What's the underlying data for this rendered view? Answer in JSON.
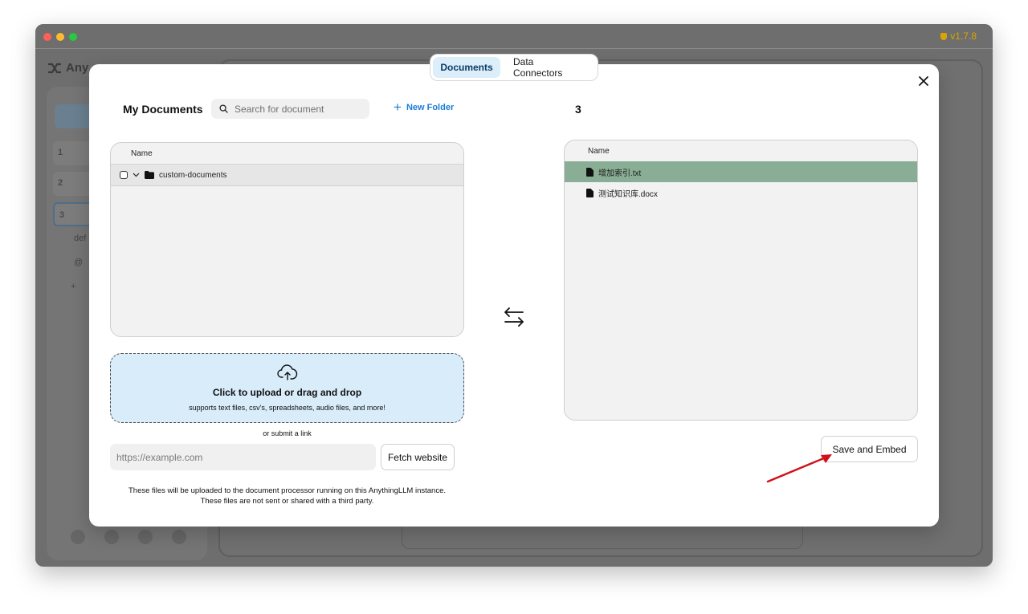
{
  "window": {
    "version": "v1.7.8"
  },
  "background": {
    "logo_text": "Any",
    "workspaces": [
      "1",
      "2",
      "3"
    ],
    "sub_items": [
      "def",
      "@",
      "+"
    ]
  },
  "modal": {
    "tabs": [
      {
        "label": "Documents",
        "active": true
      },
      {
        "label": "Data Connectors",
        "active": false
      }
    ],
    "left": {
      "title": "My Documents",
      "search_placeholder": "Search for document",
      "new_folder_label": "New Folder",
      "column_name": "Name",
      "folders": [
        {
          "name": "custom-documents"
        }
      ]
    },
    "right": {
      "count": "3",
      "column_name": "Name",
      "files": [
        {
          "name": "增加索引.txt",
          "selected": true
        },
        {
          "name": "测试知识库.docx",
          "selected": false
        }
      ]
    },
    "upload": {
      "title": "Click to upload or drag and drop",
      "subtitle": "supports text files, csv's, spreadsheets, audio files, and more!"
    },
    "link": {
      "or_text": "or submit a link",
      "url_placeholder": "https://example.com",
      "fetch_label": "Fetch website"
    },
    "notice": {
      "line1": "These files will be uploaded to the document processor running on this AnythingLLM instance.",
      "line2": "These files are not sent or shared with a third party."
    },
    "save_label": "Save and Embed"
  },
  "colors": {
    "accent": "#1d7cd6",
    "selected_row": "#8aae95",
    "upload_bg": "#d8ecfa",
    "annotation_arrow": "#d0101a"
  }
}
